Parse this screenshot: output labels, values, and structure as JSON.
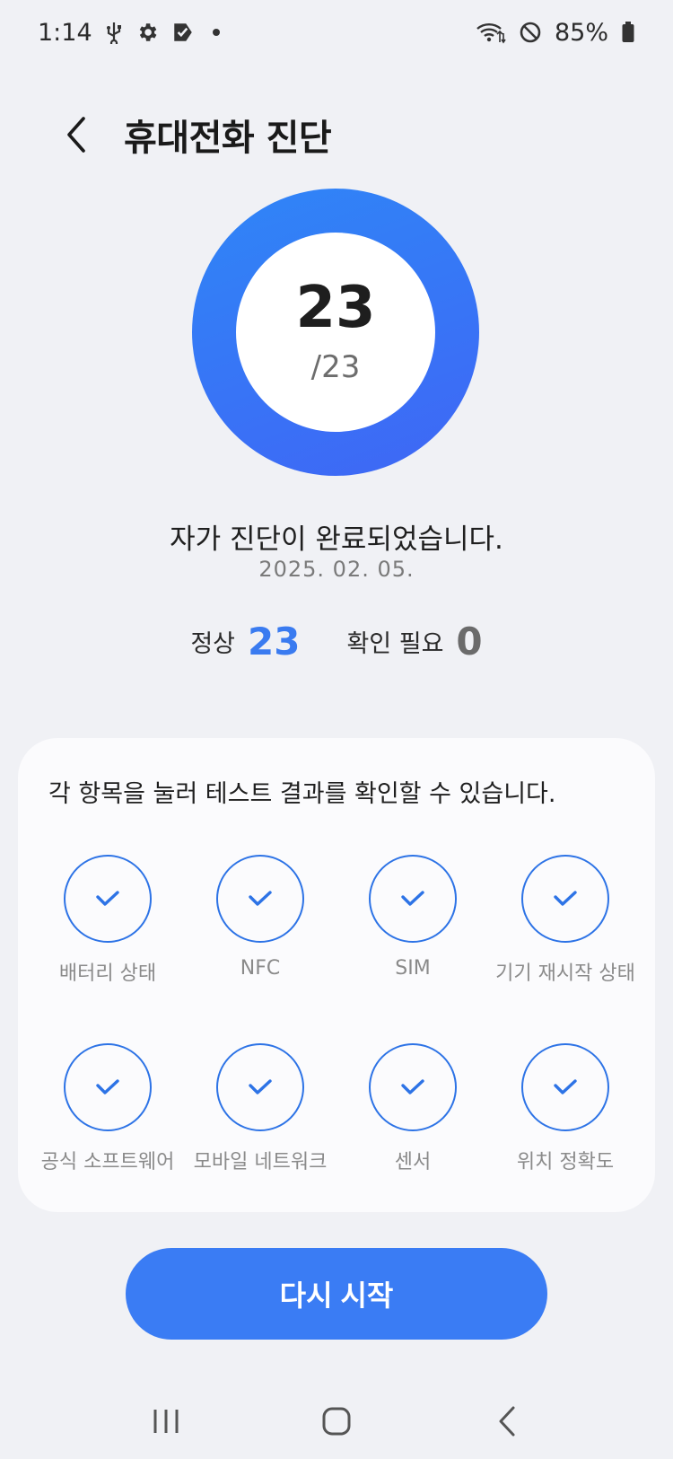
{
  "status_bar": {
    "time": "1:14",
    "battery": "85%",
    "icons_left": [
      "usb-icon",
      "gear-icon",
      "app-icon",
      "dot-icon"
    ],
    "icons_right": [
      "wifi-icon",
      "do-not-disturb-icon",
      "battery-icon"
    ]
  },
  "header": {
    "title": "휴대전화 진단"
  },
  "score": {
    "value": "23",
    "total": "/23"
  },
  "result": {
    "message": "자가 진단이 완료되었습니다.",
    "date": "2025. 02. 05."
  },
  "summary": {
    "normal_label": "정상",
    "normal_count": "23",
    "check_label": "확인 필요",
    "check_count": "0"
  },
  "card": {
    "hint": "각 항목을 눌러 테스트 결과를 확인할 수 있습니다.",
    "items": [
      {
        "label": "배터리 상태"
      },
      {
        "label": "NFC"
      },
      {
        "label": "SIM"
      },
      {
        "label": "기기 재시작 상태"
      },
      {
        "label": "공식 소프트웨어"
      },
      {
        "label": "모바일 네트워크"
      },
      {
        "label": "센서"
      },
      {
        "label": "위치 정확도"
      }
    ]
  },
  "restart_button": {
    "label": "다시 시작"
  },
  "colors": {
    "accent": "#3a7cf4",
    "ring_start": "#2f86f7",
    "ring_end": "#3f66f5",
    "background": "#f0f1f5",
    "card": "#fbfbfd"
  }
}
